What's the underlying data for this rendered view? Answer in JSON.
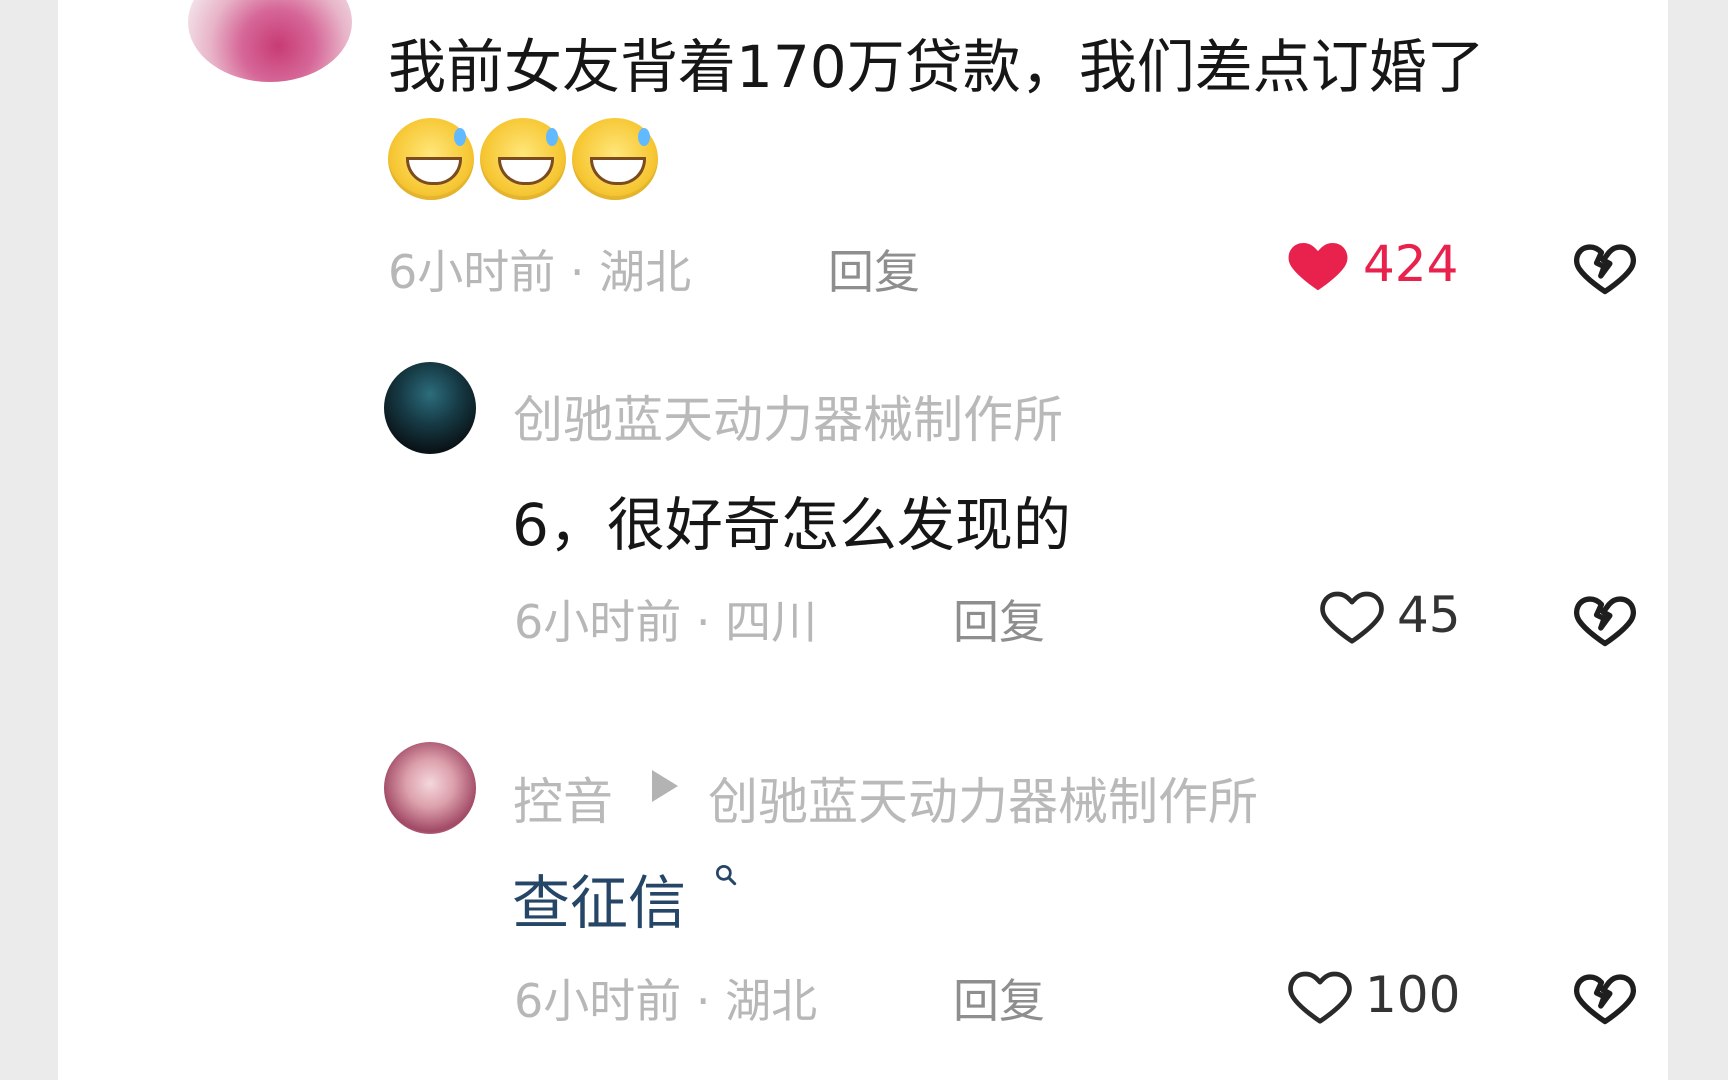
{
  "comments": {
    "main": {
      "text": "我前女友背着170万贷款，我们差点订婚了",
      "time_location": "6小时前 · 湖北",
      "reply_label": "回复",
      "likes": "424",
      "emojis": [
        "sweat-grin",
        "sweat-grin",
        "sweat-grin"
      ]
    },
    "reply1": {
      "author": "创驰蓝天动力器械制作所",
      "text": "6，很好奇怎么发现的",
      "time_location": "6小时前 · 四川",
      "reply_label": "回复",
      "likes": "45"
    },
    "reply2": {
      "author": "控音",
      "target": "创驰蓝天动力器械制作所",
      "text": "查征信",
      "time_location": "6小时前 · 湖北",
      "reply_label": "回复",
      "likes": "100"
    }
  },
  "icons": {
    "like_filled": "heart-filled-icon",
    "like_outline": "heart-outline-icon",
    "dislike": "broken-heart-icon",
    "reply_to": "triangle-right-icon",
    "search": "search-icon"
  },
  "colors": {
    "like_active": "#e8224d",
    "meta_text": "#b7b7b7",
    "reply_text": "#8e8e8e",
    "link_text": "#254666"
  }
}
